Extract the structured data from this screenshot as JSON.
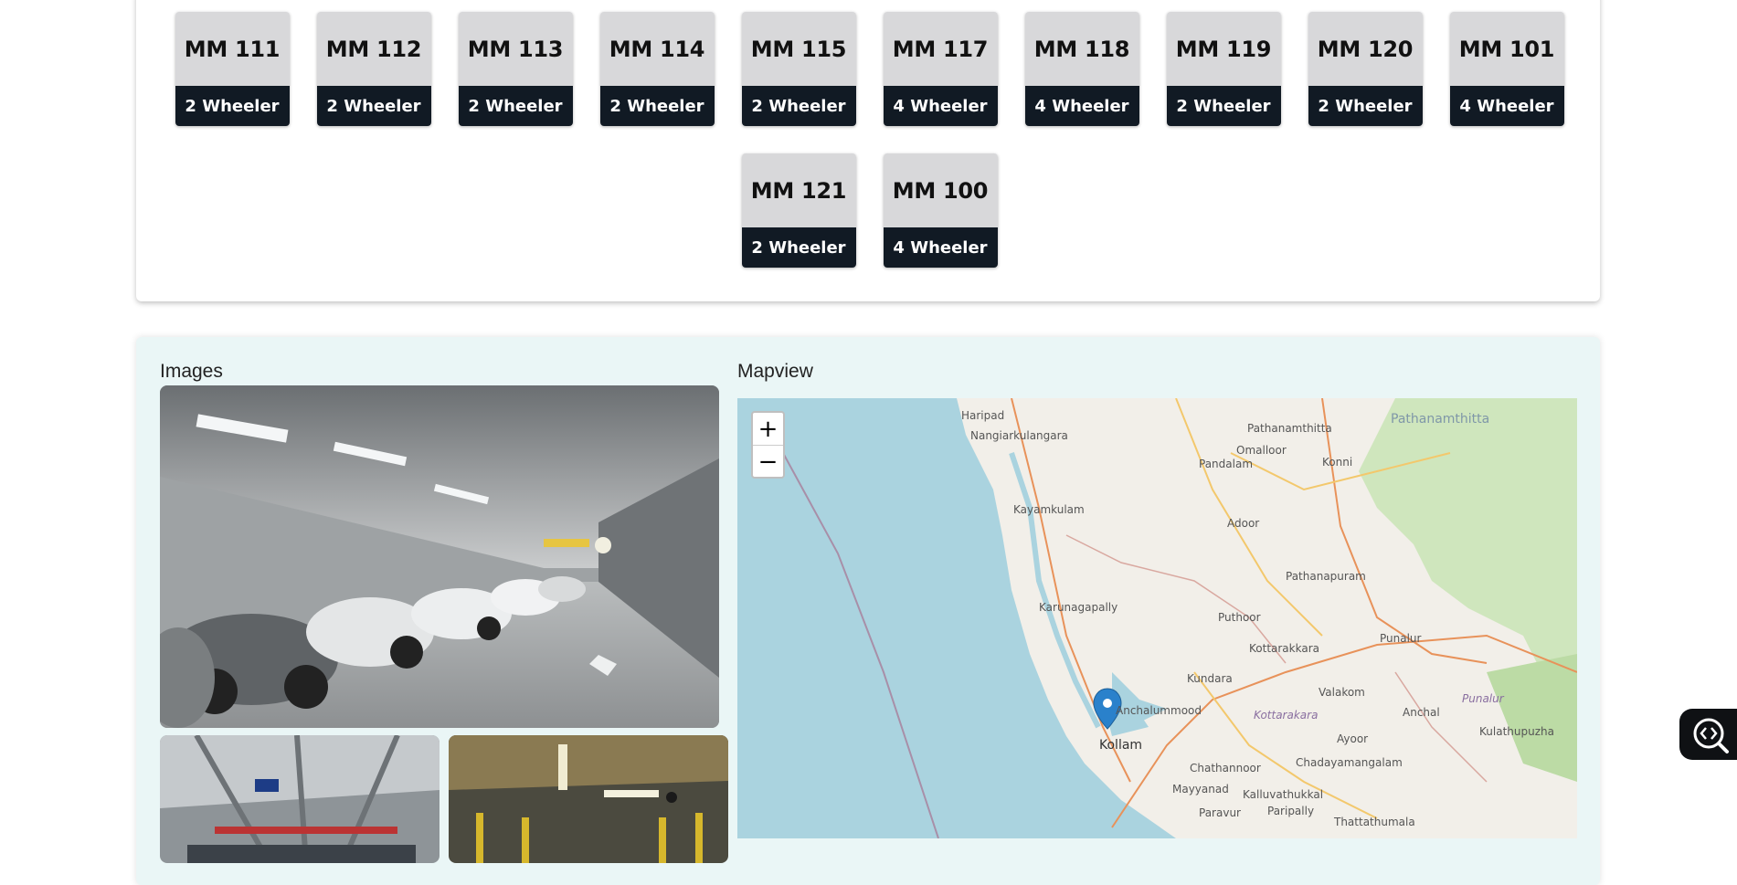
{
  "slots": [
    {
      "name": "MM 111",
      "type": "2 Wheeler"
    },
    {
      "name": "MM 112",
      "type": "2 Wheeler"
    },
    {
      "name": "MM 113",
      "type": "2 Wheeler"
    },
    {
      "name": "MM 114",
      "type": "2 Wheeler"
    },
    {
      "name": "MM 115",
      "type": "2 Wheeler"
    },
    {
      "name": "MM 117",
      "type": "4 Wheeler"
    },
    {
      "name": "MM 118",
      "type": "4 Wheeler"
    },
    {
      "name": "MM 119",
      "type": "2 Wheeler"
    },
    {
      "name": "MM 120",
      "type": "2 Wheeler"
    },
    {
      "name": "MM 101",
      "type": "4 Wheeler"
    },
    {
      "name": "MM 121",
      "type": "2 Wheeler"
    },
    {
      "name": "MM 100",
      "type": "4 Wheeler"
    }
  ],
  "images_section": {
    "title": "Images"
  },
  "map_section": {
    "title": "Mapview",
    "zoom_in": "+",
    "zoom_out": "−",
    "places": {
      "haripad": "Haripad",
      "nangiarkulangara": "Nangiarkulangara",
      "pathanamthitta_town": "Pathanamthitta",
      "pathanamthitta_region": "Pathanamthitta",
      "omalloor": "Omalloor",
      "pandalam": "Pandalam",
      "konni": "Konni",
      "kayamkulam": "Kayamkulam",
      "adoor": "Adoor",
      "pathanapuram": "Pathanapuram",
      "karunagapally": "Karunagapally",
      "puthoor": "Puthoor",
      "kottarakkara": "Kottarakkara",
      "punalur": "Punalur",
      "kundara": "Kundara",
      "valakom": "Valakom",
      "punalur_lake": "Punalur",
      "anchalummood": "Anchalummood",
      "kottarakara_region": "Kottarakara",
      "anchal": "Anchal",
      "kulathupuzha": "Kulathupuzha",
      "kollam": "Kollam",
      "ayoor": "Ayoor",
      "chathannoor": "Chathannoor",
      "chadayamangalam": "Chadayamangalam",
      "mayyanad": "Mayyanad",
      "kalluvathukkal": "Kalluvathukkal",
      "paravur": "Paravur",
      "paripally": "Paripally",
      "thattathumala": "Thattathumala"
    }
  },
  "colors": {
    "slot_top": "#d8d8da",
    "slot_bottom": "#111a24",
    "details_bg": "#eaf6f6",
    "sea": "#aad3df",
    "land": "#f2efe9",
    "marker": "#2a81cb"
  },
  "widget": {
    "icon": "code-search-icon"
  }
}
